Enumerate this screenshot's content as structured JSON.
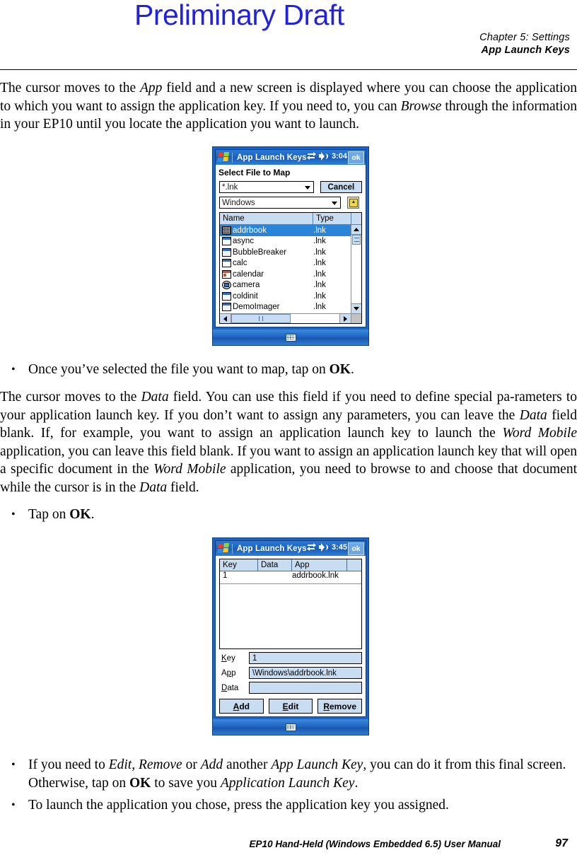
{
  "watermark": "Preliminary Draft",
  "header": {
    "line1": "Chapter 5:  Settings",
    "line2": "App Launch Keys"
  },
  "footer": {
    "title": "EP10 Hand-Held (Windows Embedded 6.5) User Manual",
    "page": "97"
  },
  "body": {
    "para1_a": "The cursor moves to the ",
    "para1_i1": "App",
    "para1_b": " field and a new screen is displayed where you can choose the application to which you want to assign the application key. If you need to, you can ",
    "para1_i2": "Browse",
    "para1_c": " through the information in your EP10 until you locate the application you want to launch.",
    "bullet1_a": "Once you’ve selected the file you want to map, tap on ",
    "bullet1_b": "OK",
    "bullet1_c": ".",
    "para2_a": "The cursor moves to the ",
    "para2_i1": "Data",
    "para2_b": " field. You can use this field if you need to define special pa-rameters to your application launch key. If you don’t want to assign any parameters, you can leave the ",
    "para2_i2": "Data",
    "para2_c": " field blank. If, for example, you want to assign an application launch key to launch the ",
    "para2_i3": "Word Mobile",
    "para2_d": " application, you can leave this field blank. If you want to assign an application launch key that will open a specific document in the ",
    "para2_i4": "Word Mobile",
    "para2_e": " application, you need to browse to and choose that document while the cursor is in the ",
    "para2_i5": "Data",
    "para2_f": " field.",
    "bullet2_a": "Tap on ",
    "bullet2_b": "OK",
    "bullet2_c": ".",
    "bullet3_a": "If you need to ",
    "bullet3_i1": "Edit",
    "bullet3_b": ", ",
    "bullet3_i2": "Remove",
    "bullet3_c": " or ",
    "bullet3_i3": "Add",
    "bullet3_d": " another ",
    "bullet3_i4": "App Launch Key",
    "bullet3_e": ", you can do it from this final screen. Otherwise, tap on ",
    "bullet3_f": "OK",
    "bullet3_g": " to save you ",
    "bullet3_i5": "Application Launch Key",
    "bullet3_h": ".",
    "bullet4": "To launch the application you chose, press the application key you assigned."
  },
  "screen1": {
    "titlebar": {
      "title": "App Launch Keys",
      "time": "3:04",
      "ok": "ok"
    },
    "heading": "Select File to Map",
    "filter_combo": "*.lnk",
    "cancel_button": "Cancel",
    "folder_combo": "Windows",
    "columns": [
      "Name",
      "Type"
    ],
    "rows": [
      {
        "name": "addrbook",
        "type": ".lnk",
        "icon": "dots",
        "selected": true
      },
      {
        "name": "async",
        "type": ".lnk",
        "icon": "win",
        "selected": false
      },
      {
        "name": "BubbleBreaker",
        "type": ".lnk",
        "icon": "win-gray",
        "selected": false
      },
      {
        "name": "calc",
        "type": ".lnk",
        "icon": "win",
        "selected": false
      },
      {
        "name": "calendar",
        "type": ".lnk",
        "icon": "cal",
        "selected": false
      },
      {
        "name": "camera",
        "type": ".lnk",
        "icon": "cam",
        "selected": false
      },
      {
        "name": "coldinit",
        "type": ".lnk",
        "icon": "win",
        "selected": false
      },
      {
        "name": "DemoImager",
        "type": ".lnk",
        "icon": "win-gray",
        "selected": false
      }
    ]
  },
  "screen2": {
    "titlebar": {
      "title": "App Launch Keys",
      "time": "3:45",
      "ok": "ok"
    },
    "columns": [
      "Key",
      "Data",
      "App"
    ],
    "rows": [
      {
        "key": "1",
        "data": "",
        "app": "addrbook.lnk"
      }
    ],
    "fields": [
      {
        "label": "Key",
        "underline": "K",
        "rest": "ey",
        "value": "1"
      },
      {
        "label": "App",
        "underline": "p",
        "rest": "",
        "value": "\\Windows\\addrbook.lnk"
      },
      {
        "label": "Data",
        "underline": "D",
        "rest": "ata",
        "value": ""
      }
    ],
    "buttons": [
      {
        "u": "A",
        "rest": "dd"
      },
      {
        "u": "E",
        "rest": "dit"
      },
      {
        "u": "R",
        "rest": "emove"
      }
    ]
  },
  "colors": {
    "watermark": "#2222dd",
    "device_frame": "#1b64c6",
    "titlebar": "#1c62bd",
    "selection": "#2a85d8",
    "control_fill": "#c9ddf2"
  }
}
